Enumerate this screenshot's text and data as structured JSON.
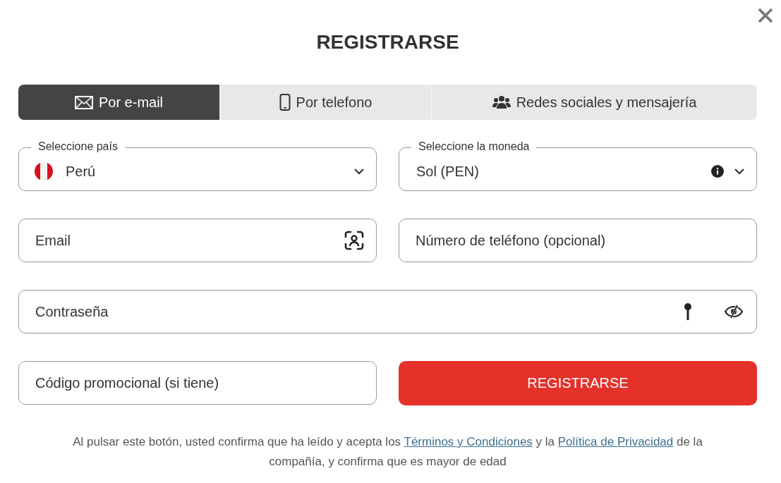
{
  "dialog": {
    "title": "REGISTRARSE"
  },
  "tabs": [
    {
      "label": "Por e-mail",
      "selected": true
    },
    {
      "label": "Por telefono",
      "selected": false
    },
    {
      "label": "Redes sociales y mensajería",
      "selected": false
    }
  ],
  "country_select": {
    "label": "Seleccione país",
    "value": "Perú"
  },
  "currency_select": {
    "label": "Seleccione la moneda",
    "value": "Sol (PEN)"
  },
  "email_field": {
    "placeholder": "Email"
  },
  "phone_field": {
    "placeholder": "Número de teléfono (opcional)"
  },
  "password_field": {
    "placeholder": "Contraseña"
  },
  "promo_field": {
    "placeholder": "Código promocional (si tiene)"
  },
  "submit_button": {
    "label": "REGISTRARSE"
  },
  "legal": {
    "before": "Al pulsar este botón, usted confirma que ha leído y acepta los",
    "terms_link": "Términos y Condiciones",
    "middle": "y la",
    "privacy_link": "Política de Privacidad",
    "after": "de la compañía, y confirma que es mayor de edad"
  }
}
